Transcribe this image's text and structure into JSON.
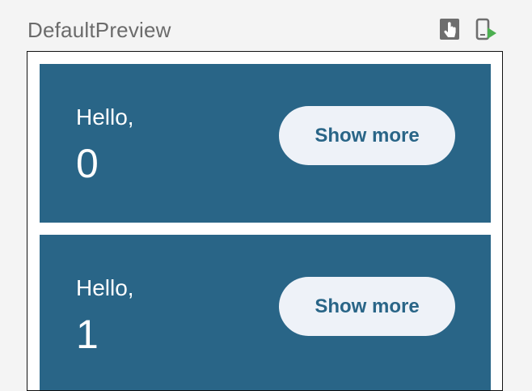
{
  "preview": {
    "title": "DefaultPreview",
    "icons": [
      "interactive-mode-icon",
      "deploy-preview-icon"
    ]
  },
  "cards": [
    {
      "greeting": "Hello,",
      "name": "0",
      "button_label": "Show more"
    },
    {
      "greeting": "Hello,",
      "name": "1",
      "button_label": "Show more"
    }
  ],
  "colors": {
    "card_background": "#296587",
    "button_background": "#eef2f8",
    "button_text": "#296587",
    "deploy_accent": "#4caf50"
  }
}
